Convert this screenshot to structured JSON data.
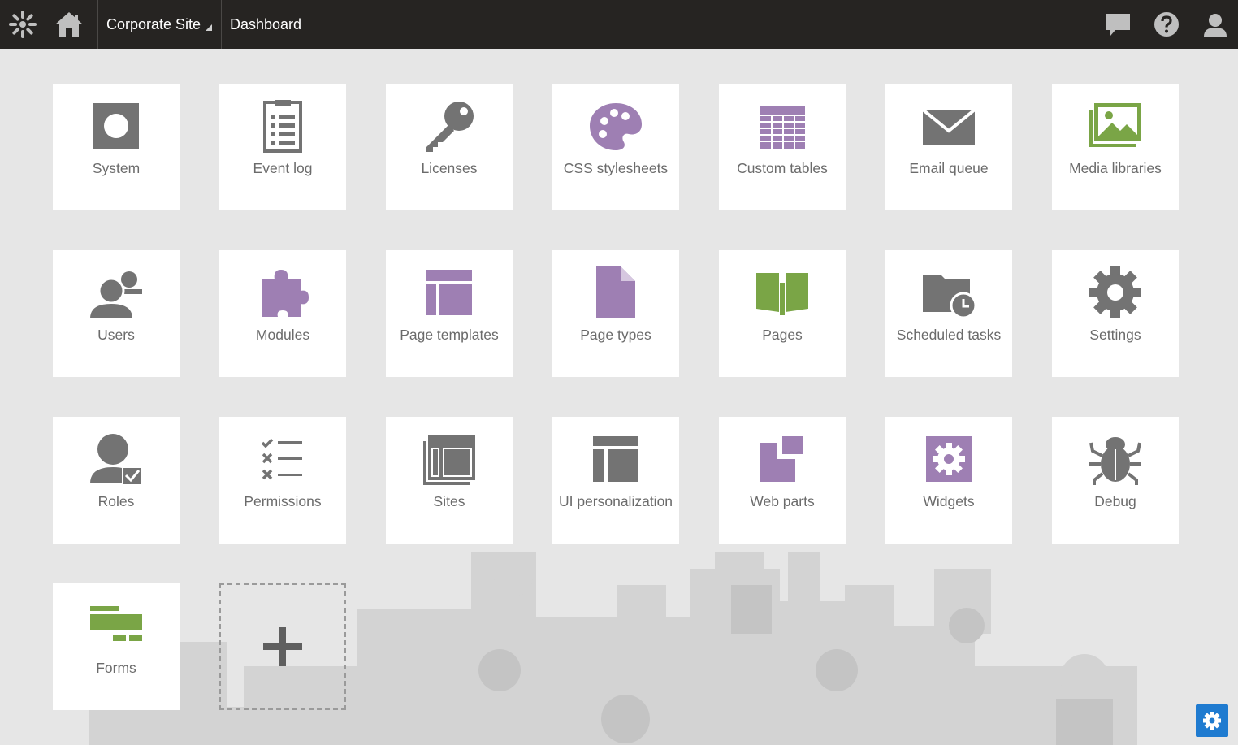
{
  "header": {
    "site_selector": "Corporate Site",
    "breadcrumb": "Dashboard"
  },
  "colors": {
    "topbar": "#262422",
    "gray_icon": "#737373",
    "purple_icon": "#9e7fb3",
    "green_icon": "#7aa546",
    "settings_button": "#1f7bd0"
  },
  "tiles": [
    {
      "label": "System",
      "icon": "system-icon",
      "color": "gray"
    },
    {
      "label": "Event log",
      "icon": "event-log-icon",
      "color": "gray"
    },
    {
      "label": "Licenses",
      "icon": "key-icon",
      "color": "gray"
    },
    {
      "label": "CSS stylesheets",
      "icon": "palette-icon",
      "color": "purple"
    },
    {
      "label": "Custom tables",
      "icon": "table-icon",
      "color": "purple"
    },
    {
      "label": "Email queue",
      "icon": "envelope-icon",
      "color": "gray"
    },
    {
      "label": "Media libraries",
      "icon": "image-icon",
      "color": "green"
    },
    {
      "label": "Users",
      "icon": "users-icon",
      "color": "gray"
    },
    {
      "label": "Modules",
      "icon": "puzzle-icon",
      "color": "purple"
    },
    {
      "label": "Page templates",
      "icon": "layout-icon",
      "color": "purple"
    },
    {
      "label": "Page types",
      "icon": "document-icon",
      "color": "purple"
    },
    {
      "label": "Pages",
      "icon": "book-icon",
      "color": "green"
    },
    {
      "label": "Scheduled tasks",
      "icon": "folder-clock-icon",
      "color": "gray"
    },
    {
      "label": "Settings",
      "icon": "gear-icon",
      "color": "gray"
    },
    {
      "label": "Roles",
      "icon": "role-icon",
      "color": "gray"
    },
    {
      "label": "Permissions",
      "icon": "checklist-icon",
      "color": "gray"
    },
    {
      "label": "Sites",
      "icon": "sites-icon",
      "color": "gray"
    },
    {
      "label": "UI personalization",
      "icon": "ui-layout-icon",
      "color": "gray"
    },
    {
      "label": "Web parts",
      "icon": "web-parts-icon",
      "color": "purple"
    },
    {
      "label": "Widgets",
      "icon": "widget-gear-icon",
      "color": "purple"
    },
    {
      "label": "Debug",
      "icon": "bug-icon",
      "color": "gray"
    },
    {
      "label": "Forms",
      "icon": "form-icon",
      "color": "green"
    }
  ]
}
